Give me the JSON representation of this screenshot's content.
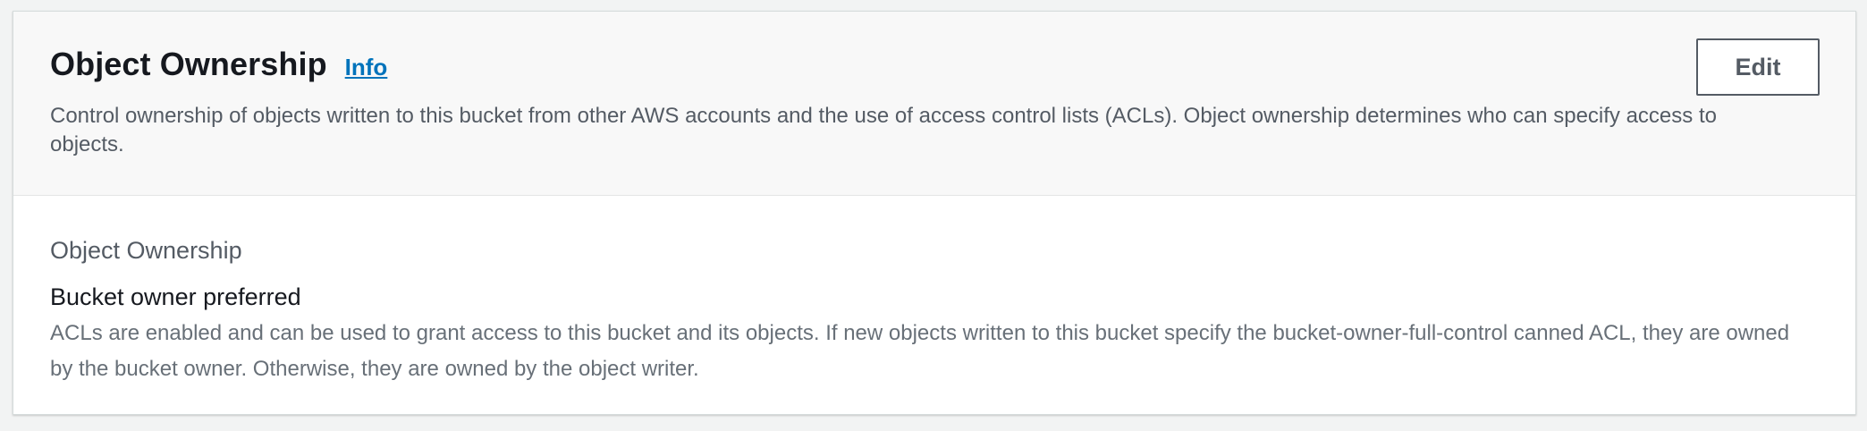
{
  "header": {
    "title": "Object Ownership",
    "info_link": "Info",
    "description": "Control ownership of objects written to this bucket from other AWS accounts and the use of access control lists (ACLs). Object ownership determines who can specify access to objects.",
    "edit_label": "Edit"
  },
  "body": {
    "field_label": "Object Ownership",
    "field_value": "Bucket owner preferred",
    "field_description": "ACLs are enabled and can be used to grant access to this bucket and its objects. If new objects written to this bucket specify the bucket-owner-full-control canned ACL, they are owned by the bucket owner. Otherwise, they are owned by the object writer."
  },
  "colors": {
    "link": "#0073bb",
    "header_background": "#f8f8f8",
    "page_background": "#f2f3f3",
    "secondary_text": "#545b64"
  }
}
